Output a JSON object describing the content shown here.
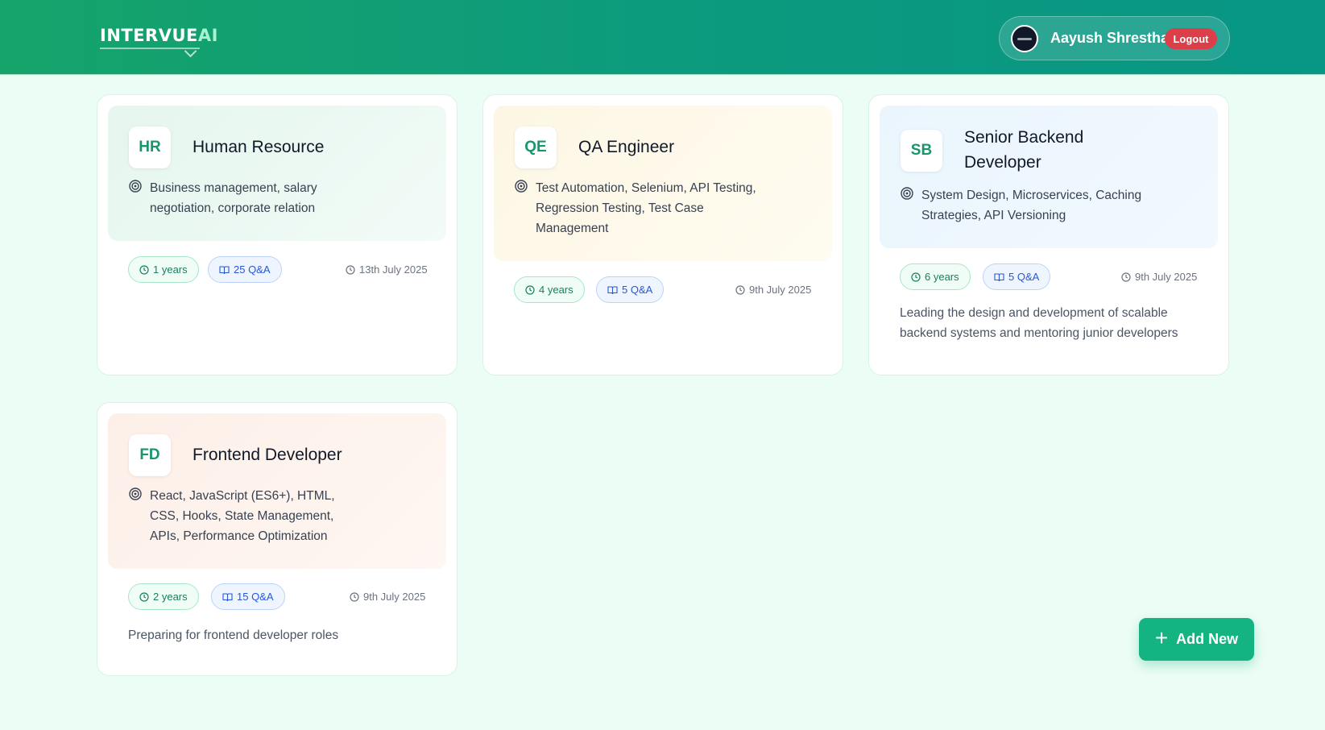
{
  "header": {
    "logo_main": "INTERVUE",
    "logo_ai": "AI",
    "user_name": "Aayush Shrestha",
    "logout_label": "Logout"
  },
  "sessions": [
    {
      "initials": "HR",
      "title": "Human Resource",
      "skills": "Business management, salary negotiation, corporate relation",
      "experience": "1 years",
      "qa_count": "25 Q&A",
      "date": "13th July 2025",
      "description": "",
      "accent": "#eaf7f1"
    },
    {
      "initials": "QE",
      "title": "QA Engineer",
      "skills": "Test Automation, Selenium, API Testing, Regression Testing, Test Case Management",
      "experience": "4 years",
      "qa_count": "5 Q&A",
      "date": "9th July 2025",
      "description": "",
      "accent": "#fefaea"
    },
    {
      "initials": "SB",
      "title": "Senior Backend Developer",
      "skills": "System Design, Microservices, Caching Strategies, API Versioning",
      "experience": "6 years",
      "qa_count": "5 Q&A",
      "date": "9th July 2025",
      "description": "Leading the design and development of scalable backend systems and mentoring junior developers",
      "accent": "#eef7fe"
    },
    {
      "initials": "FD",
      "title": "Frontend Developer",
      "skills": "React, JavaScript (ES6+), HTML, CSS, Hooks, State Management, APIs, Performance Optimization",
      "experience": "2 years",
      "qa_count": "15 Q&A",
      "date": "9th July 2025",
      "description": "Preparing for frontend developer roles",
      "accent": "#fef3ee"
    }
  ],
  "add_button": {
    "icon": "plus-icon",
    "label": "Add New"
  },
  "colors": {
    "header_gradient_start": "#16a36a",
    "header_gradient_end": "#089685",
    "background": "#ecfdf5",
    "logout": "#dc3e4a",
    "add_button": "#14b482",
    "initials_text": "#17966b"
  }
}
